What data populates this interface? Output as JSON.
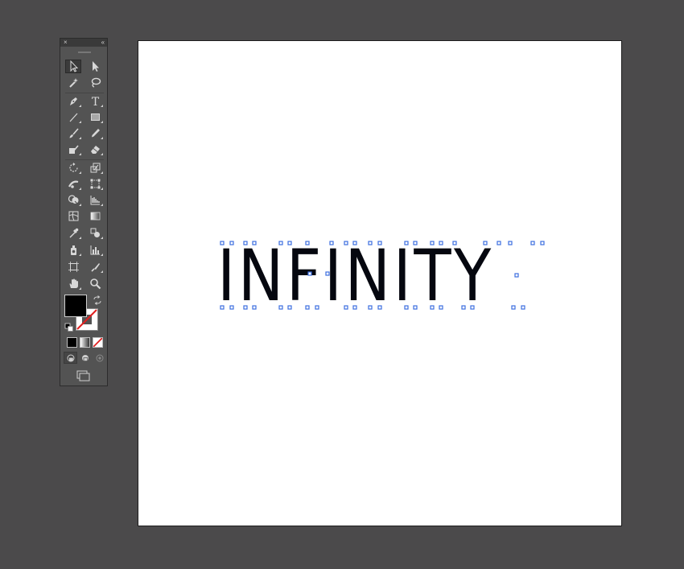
{
  "toolbar": {
    "close_glyph": "×",
    "collapse_glyph": "‹‹",
    "tools": [
      {
        "name": "selection-tool",
        "icon": "selection-arrow-icon"
      },
      {
        "name": "direct-selection-tool",
        "icon": "direct-selection-arrow-icon"
      },
      {
        "name": "magic-wand-tool",
        "icon": "magic-wand-icon"
      },
      {
        "name": "lasso-tool",
        "icon": "lasso-icon"
      },
      {
        "name": "pen-tool",
        "icon": "pen-nib-icon"
      },
      {
        "name": "type-tool",
        "icon": "type-t-icon",
        "glyph": "T"
      },
      {
        "name": "line-segment-tool",
        "icon": "line-segment-icon"
      },
      {
        "name": "rectangle-tool",
        "icon": "rectangle-icon"
      },
      {
        "name": "paintbrush-tool",
        "icon": "paintbrush-icon"
      },
      {
        "name": "pencil-tool",
        "icon": "pencil-icon"
      },
      {
        "name": "shaper-tool",
        "icon": "shaper-icon"
      },
      {
        "name": "eraser-tool",
        "icon": "eraser-icon"
      },
      {
        "name": "rotate-tool",
        "icon": "rotate-icon"
      },
      {
        "name": "scale-tool",
        "icon": "scale-icon"
      },
      {
        "name": "width-tool",
        "icon": "width-icon"
      },
      {
        "name": "free-transform-tool",
        "icon": "free-transform-icon"
      },
      {
        "name": "shape-builder-tool",
        "icon": "shape-builder-icon"
      },
      {
        "name": "perspective-grid-tool",
        "icon": "perspective-grid-icon"
      },
      {
        "name": "mesh-tool",
        "icon": "mesh-icon"
      },
      {
        "name": "gradient-tool",
        "icon": "gradient-icon"
      },
      {
        "name": "eyedropper-tool",
        "icon": "eyedropper-icon"
      },
      {
        "name": "blend-tool",
        "icon": "blend-icon"
      },
      {
        "name": "symbol-sprayer-tool",
        "icon": "symbol-sprayer-icon"
      },
      {
        "name": "column-graph-tool",
        "icon": "column-graph-icon"
      },
      {
        "name": "artboard-tool",
        "icon": "artboard-icon"
      },
      {
        "name": "slice-tool",
        "icon": "slice-knife-icon"
      },
      {
        "name": "hand-tool",
        "icon": "hand-icon"
      },
      {
        "name": "zoom-tool",
        "icon": "magnifier-icon"
      }
    ],
    "fill_color": "#000000",
    "stroke_color": "none",
    "color_modes": [
      "color-mode-icon",
      "gradient-mode-icon",
      "none-mode-icon"
    ],
    "draw_modes": [
      "draw-normal-icon",
      "draw-behind-icon",
      "draw-inside-icon"
    ],
    "screen_mode_icon": "screen-mode-icon"
  },
  "artboard": {
    "background": "#ffffff",
    "text": "INFINITY",
    "text_color": "#05070f",
    "anchor_color": "#3d6fe0"
  }
}
